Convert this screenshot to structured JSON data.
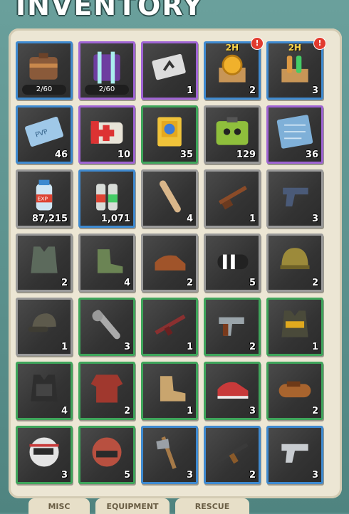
{
  "header": {
    "title": "INVENTORY"
  },
  "tabs": [
    {
      "label": "MISC"
    },
    {
      "label": "EQUIPMENT"
    },
    {
      "label": "RESCUE"
    }
  ],
  "colors": {
    "blue": "#3f8ad0",
    "purple": "#9f64d4",
    "green": "#3fa55b",
    "gray": "#9a9a9a",
    "badge": "#e23b2e",
    "timer": "#ffd84a"
  },
  "slots": [
    {
      "item": "backpack",
      "rarity": "blue",
      "capacity": "2/60",
      "count": ""
    },
    {
      "item": "container",
      "rarity": "purple",
      "capacity": "2/60",
      "count": ""
    },
    {
      "item": "ticket-card",
      "rarity": "purple",
      "count": "1"
    },
    {
      "item": "gold-coin-crate",
      "rarity": "blue",
      "count": "2",
      "timer": "2H",
      "alert": "!"
    },
    {
      "item": "bottle-crate",
      "rarity": "blue",
      "count": "3",
      "timer": "2H",
      "alert": "!"
    },
    {
      "item": "pvp-ticket",
      "rarity": "blue",
      "count": "46"
    },
    {
      "item": "medkit",
      "rarity": "purple",
      "count": "10"
    },
    {
      "item": "book",
      "rarity": "green",
      "count": "35"
    },
    {
      "item": "green-case",
      "rarity": "gray",
      "count": "129"
    },
    {
      "item": "blueprint",
      "rarity": "purple",
      "count": "36"
    },
    {
      "item": "exp-bottle",
      "rarity": "gray",
      "count": "87,215"
    },
    {
      "item": "energy-drinks",
      "rarity": "blue",
      "count": "1,071"
    },
    {
      "item": "wooden-bat",
      "rarity": "gray",
      "count": "4"
    },
    {
      "item": "rifle",
      "rarity": "gray",
      "count": "1"
    },
    {
      "item": "pistol",
      "rarity": "gray",
      "count": "3"
    },
    {
      "item": "vest",
      "rarity": "gray",
      "count": "2"
    },
    {
      "item": "boots",
      "rarity": "gray",
      "count": "4"
    },
    {
      "item": "shoes",
      "rarity": "gray",
      "count": "2"
    },
    {
      "item": "slides",
      "rarity": "gray",
      "count": "5"
    },
    {
      "item": "helmet",
      "rarity": "gray",
      "count": "2"
    },
    {
      "item": "cap",
      "rarity": "gray",
      "count": "1"
    },
    {
      "item": "spiked-bat",
      "rarity": "green",
      "count": "3"
    },
    {
      "item": "assault-rifle",
      "rarity": "green",
      "count": "1"
    },
    {
      "item": "revolver",
      "rarity": "green",
      "count": "2"
    },
    {
      "item": "tactical-vest",
      "rarity": "green",
      "count": "1"
    },
    {
      "item": "armor-vest",
      "rarity": "green",
      "count": "4"
    },
    {
      "item": "sweater",
      "rarity": "green",
      "count": "2"
    },
    {
      "item": "hiking-boots",
      "rarity": "green",
      "count": "1"
    },
    {
      "item": "sneakers",
      "rarity": "green",
      "count": "3"
    },
    {
      "item": "sandals",
      "rarity": "green",
      "count": "2"
    },
    {
      "item": "motorcycle-helmet",
      "rarity": "green",
      "count": "3"
    },
    {
      "item": "military-helmet",
      "rarity": "green",
      "count": "5"
    },
    {
      "item": "hatchet",
      "rarity": "blue",
      "count": "3"
    },
    {
      "item": "ak-rifle",
      "rarity": "blue",
      "count": "2"
    },
    {
      "item": "silver-pistol",
      "rarity": "blue",
      "count": "3"
    }
  ]
}
